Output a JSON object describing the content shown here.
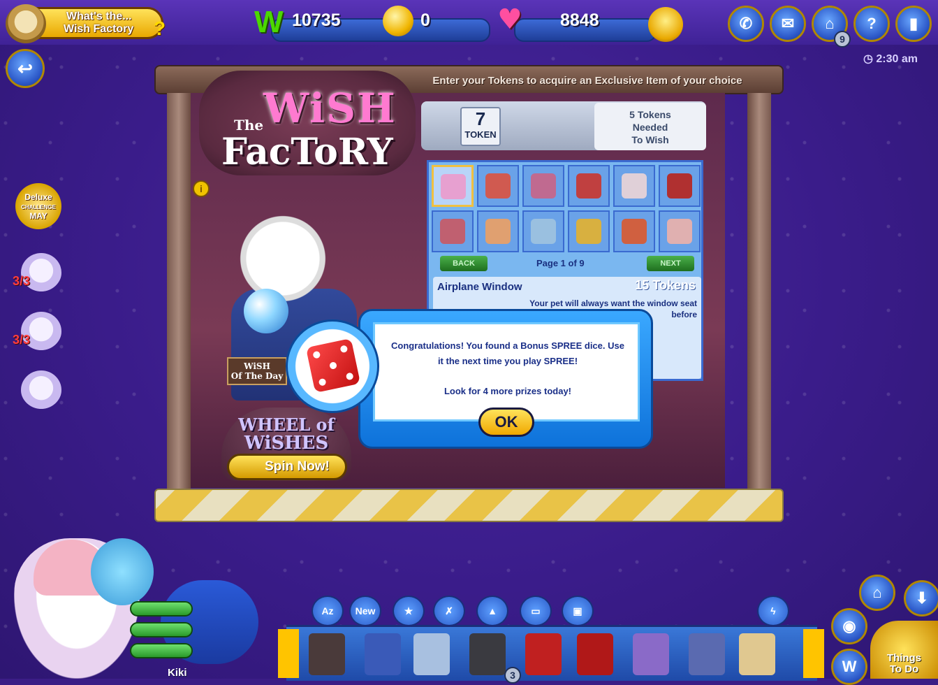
{
  "header": {
    "whats_line1": "What's the...",
    "whats_line2": "Wish Factory",
    "whats_q": "?",
    "kinzcash": "10735",
    "gems": "0",
    "happiness": "8848",
    "nav_badge": "9",
    "clock": "2:30 am"
  },
  "sidebar": {
    "deluxe_line1": "Deluxe",
    "deluxe_line2": "CHALLENGE",
    "deluxe_line3": "MAY",
    "challenges": [
      {
        "count": "3/3"
      },
      {
        "count": "3/3"
      },
      {
        "count": ""
      }
    ]
  },
  "wish_factory": {
    "caption": "Enter your Tokens to acquire an Exclusive Item of your choice",
    "logo_the": "The",
    "logo_wish": "WiSH",
    "logo_factory": "FacToRY",
    "tokens": "7",
    "token_unit": "TOKEN",
    "needed_count": "5",
    "needed_line1": "Tokens",
    "needed_line2": "Needed",
    "needed_line3": "To Wish",
    "wish_of_day_line1": "WiSH",
    "wish_of_day_line2": "Of The Day",
    "wheel_line1": "WHEEL of",
    "wheel_line2": "WiSHES",
    "spin_label": "Spin Now!",
    "back_label": "BACK",
    "next_label": "NEXT",
    "page_label": "Page 1 of 9",
    "item_name": "Airplane Window",
    "item_cost": "15 Tokens",
    "item_desc_line1": "Your pet will always want the window seat",
    "item_desc_line2": "before",
    "info_label": "i"
  },
  "modal": {
    "message_line1": "Congratulations! You found a Bonus SPREE dice. Use it the next time you play SPREE!",
    "message_line2": "Look for 4 more prizes today!",
    "ok_label": "OK"
  },
  "bottom": {
    "pet_name": "Kiki",
    "tabs": [
      "Az",
      "New",
      "",
      "",
      "",
      "",
      ""
    ],
    "things_line1": "Things",
    "things_line2": "To Do",
    "inv_badge": "3"
  },
  "colors": {
    "background": "#3b1d86",
    "modal_blue": "#1a8cf0",
    "accent_gold": "#f0b500",
    "kinzcash_green": "#4bd800"
  }
}
